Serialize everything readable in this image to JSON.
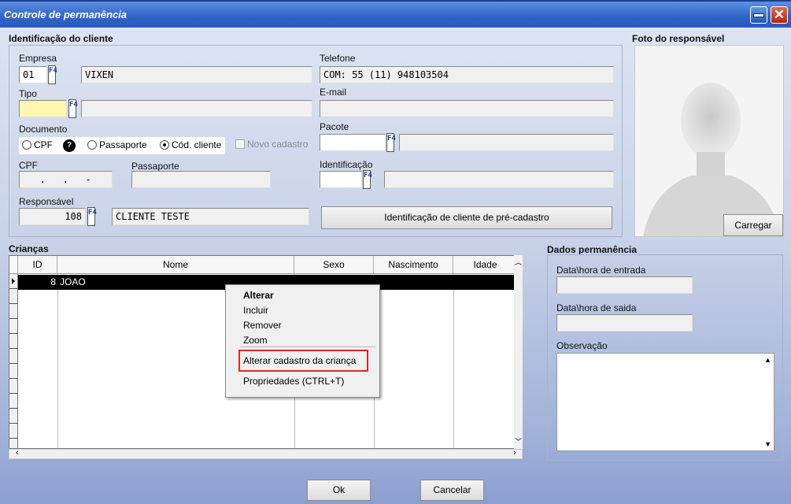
{
  "window": {
    "title": "Controle de permanência",
    "minimize_label": "–",
    "close_label": "✕"
  },
  "client_section": {
    "title": "Identificação do cliente",
    "empresa_label": "Empresa",
    "empresa_code": "01",
    "empresa_name": "VIXEN",
    "f4_label": "F4",
    "telefone_label": "Telefone",
    "telefone_value": "COM: 55 (11) 948103504",
    "tipo_label": "Tipo",
    "tipo_value": "",
    "tipo_desc": "",
    "email_label": "E-mail",
    "email_value": "",
    "documento_label": "Documento",
    "doc_options": [
      "CPF",
      "Passaporte",
      "Cód. cliente"
    ],
    "doc_selected": "Cód. cliente",
    "help_icon": "?",
    "novo_cadastro_label": "Novo cadastro",
    "pacote_label": "Pacote",
    "pacote_value": "",
    "pacote_desc": "",
    "cpf_label": "CPF",
    "cpf_value": "   .   .   -",
    "passaporte_label": "Passaporte",
    "passaporte_value": "",
    "identificacao_label": "Identificação",
    "identificacao_value": "",
    "identificacao_desc": "",
    "responsavel_label": "Responsável",
    "responsavel_code": "108",
    "responsavel_name": "CLIENTE TESTE",
    "precadastro_button": "Identificação de cliente de pré-cadastro"
  },
  "photo_section": {
    "title": "Foto do responsável",
    "carregar_button": "Carregar"
  },
  "children_section": {
    "title": "Crianças",
    "columns": [
      "ID",
      "Nome",
      "Sexo",
      "Nascimento",
      "Idade"
    ],
    "rows": [
      {
        "id": "8",
        "nome": "JOAO",
        "sexo": "",
        "nascimento": "",
        "idade": ""
      }
    ]
  },
  "context_menu": {
    "items": [
      "Alterar",
      "Incluir",
      "Remover",
      "Zoom",
      "Alterar cadastro da criança",
      "Propriedades (CTRL+T)"
    ],
    "highlighted": "Alterar cadastro da criança"
  },
  "stay_section": {
    "title": "Dados permanência",
    "entrada_label": "Data\\hora de entrada",
    "entrada_value": "",
    "saida_label": "Data\\hora de saida",
    "saida_value": "",
    "observacao_label": "Observação",
    "observacao_value": ""
  },
  "footer": {
    "ok_button": "Ok",
    "cancel_button": "Cancelar"
  },
  "colors": {
    "title_bar": "#2f63c9",
    "highlight_border": "#e0252a",
    "selected_row": "#000000"
  }
}
